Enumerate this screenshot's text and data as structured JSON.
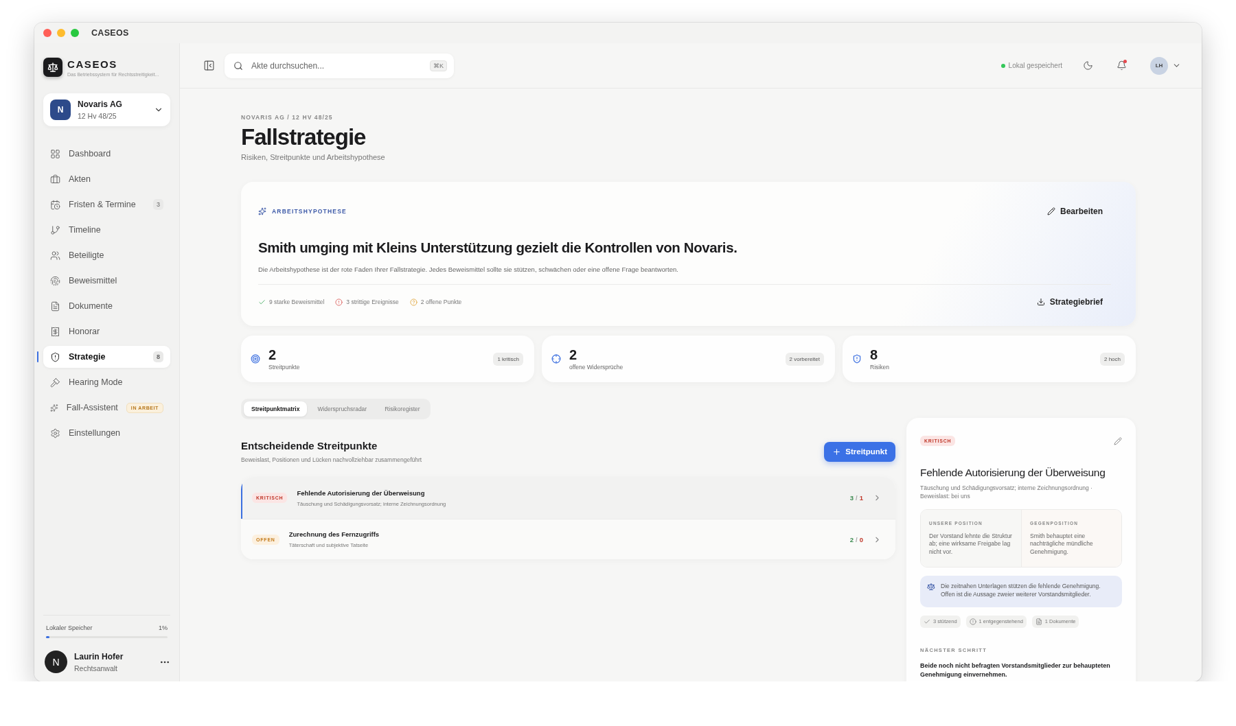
{
  "window": {
    "title": "CASEOS"
  },
  "sidebar": {
    "brand": {
      "name": "CASEOS",
      "tagline": "Das Betriebssystem für Rechtsstreitigkeit..."
    },
    "case": {
      "initial": "N",
      "name": "Novaris AG",
      "number": "12 Hv 48/25"
    },
    "items": [
      {
        "label": "Dashboard",
        "selected": false
      },
      {
        "label": "Akten",
        "selected": false
      },
      {
        "label": "Fristen & Termine",
        "selected": false,
        "badge": "3"
      },
      {
        "label": "Timeline",
        "selected": false
      },
      {
        "label": "Beteiligte",
        "selected": false
      },
      {
        "label": "Beweismittel",
        "selected": false
      },
      {
        "label": "Dokumente",
        "selected": false
      },
      {
        "label": "Honorar",
        "selected": false
      },
      {
        "label": "Strategie",
        "selected": true,
        "badge": "8"
      },
      {
        "label": "Hearing Mode",
        "selected": false
      },
      {
        "label": "Fall-Assistent",
        "selected": false,
        "status_tag": "IN ARBEIT"
      },
      {
        "label": "Einstellungen",
        "selected": false
      }
    ],
    "storage": {
      "label": "Lokaler Speicher",
      "value": "1%",
      "level": 0.01
    },
    "user": {
      "initial": "N",
      "name": "Laurin Hofer",
      "role": "Rechtsanwalt"
    }
  },
  "topbar": {
    "search": {
      "placeholder": "Akte durchsuchen...",
      "shortcut": "⌘K"
    },
    "save_status": {
      "label": "Lokal gespeichert",
      "color": "#34c759"
    },
    "notifications_unread": true,
    "avatar": "LH"
  },
  "page": {
    "breadcrumb": "NOVARIS AG / 12 HV 48/25",
    "title": "Fallstrategie",
    "subtitle": "Risiken, Streitpunkte und Arbeitshypothese"
  },
  "hypothesis": {
    "label": "ARBEITSHYPOTHESE",
    "edit": "Bearbeiten",
    "statement": "Smith umging mit Kleins Unterstützung gezielt die Kontrollen von Novaris.",
    "description": "Die Arbeitshypothese ist der rote Faden Ihrer Fallstrategie. Jedes Beweismittel sollte sie stützen, schwächen oder eine offene Frage beantworten.",
    "indicators": [
      {
        "kind": "check",
        "label": "9 starke Beweismittel"
      },
      {
        "kind": "alert",
        "label": "3 strittige Ereignisse"
      },
      {
        "kind": "question",
        "label": "2 offene Punkte"
      }
    ],
    "export": "Strategiebrief"
  },
  "stats": [
    {
      "value": "2",
      "label": "Streitpunkte",
      "badge": "1 kritisch"
    },
    {
      "value": "2",
      "label": "offene Widersprüche",
      "badge": "2 vorbereitet"
    },
    {
      "value": "8",
      "label": "Risiken",
      "badge": "2 hoch"
    }
  ],
  "tabs": [
    {
      "label": "Streitpunktmatrix",
      "selected": true
    },
    {
      "label": "Widerspruchsradar",
      "selected": false
    },
    {
      "label": "Risikoregister",
      "selected": false
    }
  ],
  "issues": {
    "title": "Entscheidende Streitpunkte",
    "subtitle": "Beweislast, Positionen und Lücken nachvollziehbar zusammengeführt",
    "add_button": "Streitpunkt",
    "rows": [
      {
        "status": "KRITISCH",
        "kind": "critical",
        "title": "Fehlende Autorisierung der Überweisung",
        "subtitle": "Täuschung und Schädigungsvorsatz; interne Zeichnungsordnung",
        "support": "3",
        "divider": "/",
        "against": "1",
        "selected": true
      },
      {
        "status": "OFFEN",
        "kind": "open",
        "title": "Zurechnung des Fernzugriffs",
        "subtitle": "Täterschaft und subjektive Tatseite",
        "support": "2",
        "divider": "/",
        "against": "0",
        "selected": false
      }
    ]
  },
  "detail": {
    "status": "KRITISCH",
    "kind": "critical",
    "title": "Fehlende Autorisierung der Überweisung",
    "subtitle": "Täuschung und Schädigungsvorsatz; interne Zeichnungsordnung · Beweislast: bei uns",
    "positions": [
      {
        "label": "UNSERE POSITION",
        "text": "Der Vorstand lehnte die Struktur ab; eine wirksame Freigabe lag nicht vor."
      },
      {
        "label": "GEGENPOSITION",
        "text": "Smith behauptet eine nachträgliche mündliche Genehmigung."
      }
    ],
    "assessment": "Die zeitnahen Unterlagen stützen die fehlende Genehmigung. Offen ist die Aussage zweier weiterer Vorstandsmitglieder.",
    "chips": [
      {
        "kind": "check",
        "label": "3 stützend"
      },
      {
        "kind": "alert",
        "label": "1 entgegenstehend"
      },
      {
        "kind": "document",
        "label": "1 Dokumente"
      }
    ],
    "next_step": {
      "label": "NÄCHSTER SCHRITT",
      "text": "Beide noch nicht befragten Vorstandsmitglieder zur behaupteten Genehmigung einvernehmen."
    }
  }
}
